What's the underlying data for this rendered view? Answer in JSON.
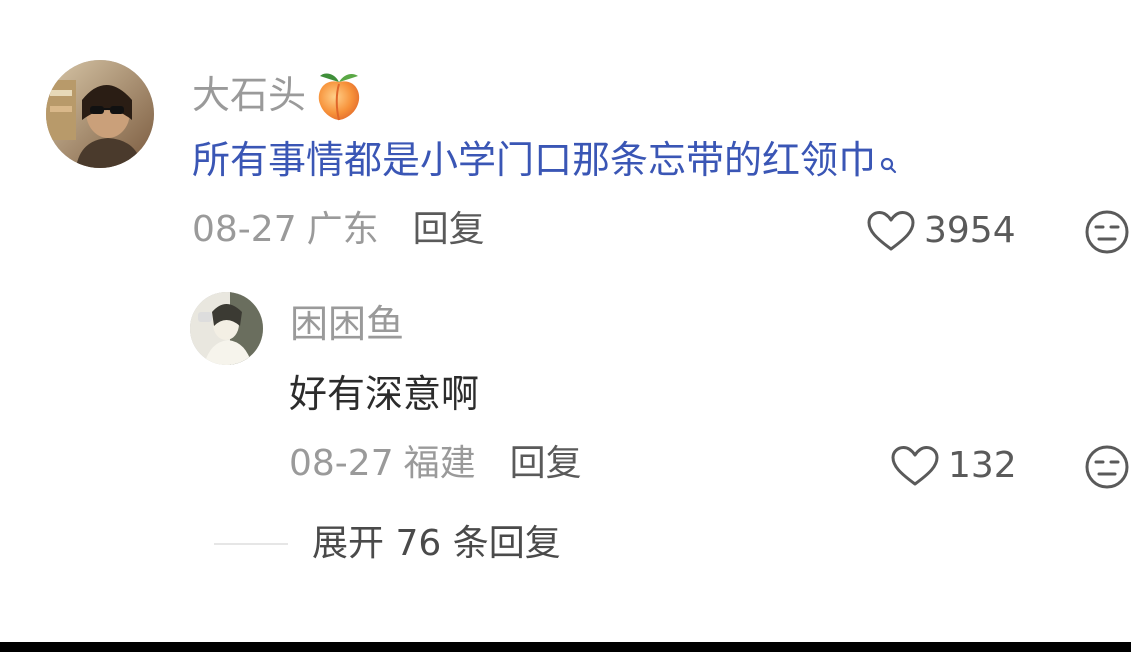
{
  "comments": [
    {
      "username": "大石头",
      "username_badge_icon": "peach-emoji-icon",
      "text": "所有事情都是小学门口那条忘带的红领巾",
      "search_icon": "search-icon",
      "date": "08-27",
      "location": "广东",
      "reply_label": "回复",
      "like_icon": "heart-outline-icon",
      "like_count": "3954",
      "dislike_icon": "meh-face-icon"
    }
  ],
  "replies": [
    {
      "username": "困困鱼",
      "text": "好有深意啊",
      "date": "08-27",
      "location": "福建",
      "reply_label": "回复",
      "like_icon": "heart-outline-icon",
      "like_count": "132",
      "dislike_icon": "meh-face-icon"
    }
  ],
  "expand": {
    "label": "展开 76 条回复"
  },
  "colors": {
    "link_blue": "#3a56b5",
    "muted_gray": "#9a9a9a",
    "text_dark": "#2c2c2c",
    "bar_black": "#000000"
  }
}
